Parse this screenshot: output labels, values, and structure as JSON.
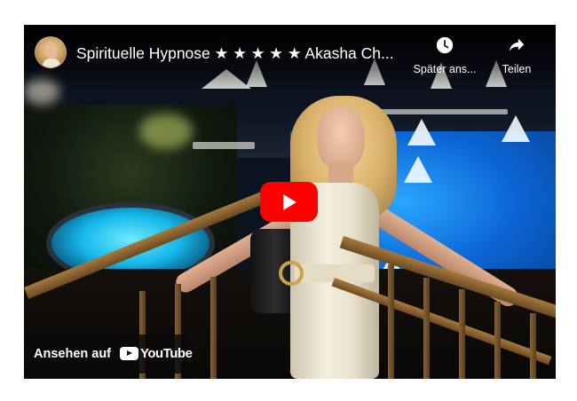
{
  "video": {
    "title": "Spirituelle Hypnose ★ ★ ★ ★ ★ Akasha Ch...",
    "channel_avatar_icon": "channel-avatar",
    "play_icon": "play-icon"
  },
  "controls": {
    "watch_later": {
      "label": "Später ans...",
      "icon": "clock-icon"
    },
    "share": {
      "label": "Teilen",
      "icon": "share-arrow-icon"
    }
  },
  "watch_on": {
    "label": "Ansehen auf",
    "brand": "YouTube",
    "brand_icon": "youtube-logo-icon"
  },
  "colors": {
    "play_button": "#ff0000",
    "overlay_text": "#ffffff"
  }
}
